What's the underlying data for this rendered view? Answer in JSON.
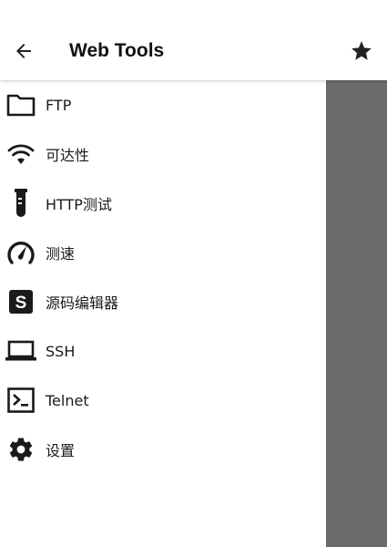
{
  "appbar": {
    "back_icon": "arrow-back-icon",
    "title": "Web Tools",
    "star_icon": "star-icon"
  },
  "drawer": {
    "items": [
      {
        "label": "FTP",
        "icon": "folder-icon"
      },
      {
        "label": "可达性",
        "icon": "wifi-icon"
      },
      {
        "label": "HTTP测试",
        "icon": "test-tube-icon"
      },
      {
        "label": "测速",
        "icon": "speedometer-icon"
      },
      {
        "label": "源码编辑器",
        "icon": "source-s-icon"
      },
      {
        "label": "SSH",
        "icon": "laptop-icon"
      },
      {
        "label": "Telnet",
        "icon": "console-icon"
      },
      {
        "label": "设置",
        "icon": "gear-icon"
      }
    ]
  },
  "colors": {
    "scrim": "#6a6a6a",
    "icon": "#1a1a1a",
    "background": "#ffffff"
  }
}
